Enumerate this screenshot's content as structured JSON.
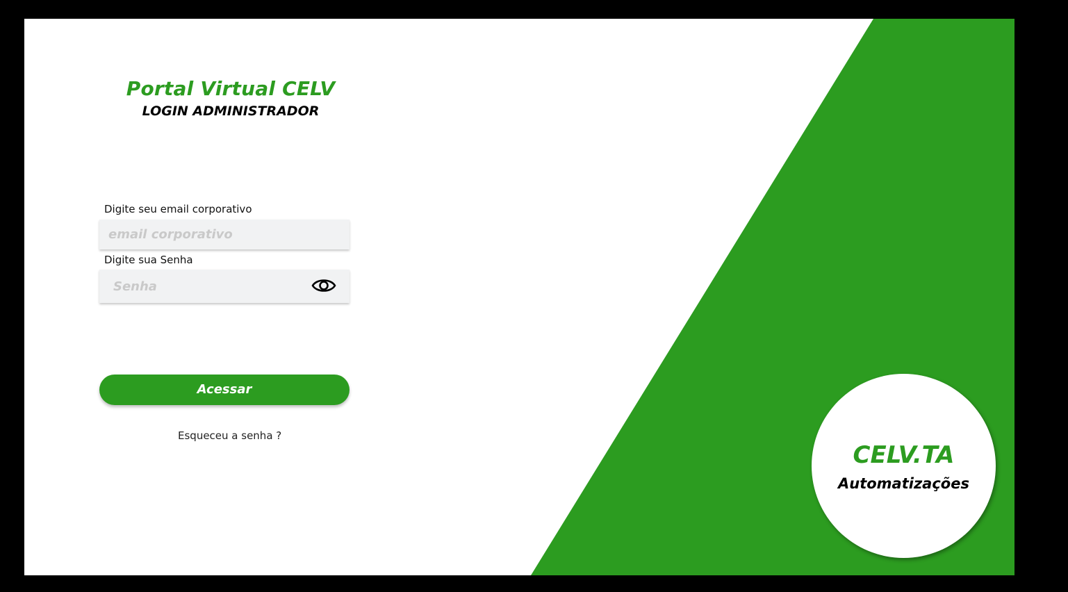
{
  "header": {
    "title": "Portal Virtual CELV",
    "subtitle": "LOGIN ADMINISTRADOR"
  },
  "form": {
    "email_label": "Digite seu email corporativo",
    "email_placeholder": "email corporativo",
    "email_value": "",
    "password_label": "Digite sua Senha",
    "password_placeholder": "Senha",
    "password_value": "",
    "submit_label": "Acessar",
    "forgot_label": "Esqueceu a senha ?"
  },
  "brand": {
    "name": "CELV.TA",
    "tagline": "Automatizações"
  },
  "icons": {
    "password_toggle": "eye-icon"
  },
  "colors": {
    "brand_green": "#2c9c20",
    "background": "#ffffff",
    "frame": "#000000",
    "input_bg": "#f1f2f3",
    "placeholder": "#c9c9c9"
  }
}
